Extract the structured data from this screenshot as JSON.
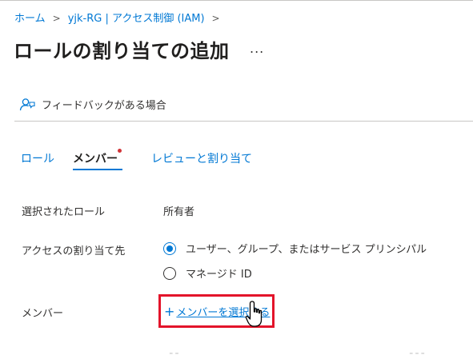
{
  "breadcrumb": {
    "home": "ホーム",
    "resource": "yjk-RG | アクセス制御 (IAM)",
    "separator": ">"
  },
  "page": {
    "title": "ロールの割り当ての追加",
    "more": "..."
  },
  "feedback": {
    "label": "フィードバックがある場合"
  },
  "tabs": [
    {
      "label": "ロール",
      "active": false
    },
    {
      "label": "メンバー",
      "active": true,
      "required": true
    },
    {
      "label": "レビューと割り当て",
      "active": false
    }
  ],
  "form": {
    "selected_role": {
      "label": "選択されたロール",
      "value": "所有者"
    },
    "assign_access_to": {
      "label": "アクセスの割り当て先",
      "options": [
        {
          "label": "ユーザー、グループ、またはサービス プリンシパル",
          "checked": true
        },
        {
          "label": "マネージド ID",
          "checked": false
        }
      ]
    },
    "members": {
      "label": "メンバー",
      "action": "メンバーを選択する",
      "action_prefix": "+"
    }
  },
  "colors": {
    "accent": "#0078d4",
    "highlight": "#e3142a",
    "required_dot": "#d13438"
  }
}
